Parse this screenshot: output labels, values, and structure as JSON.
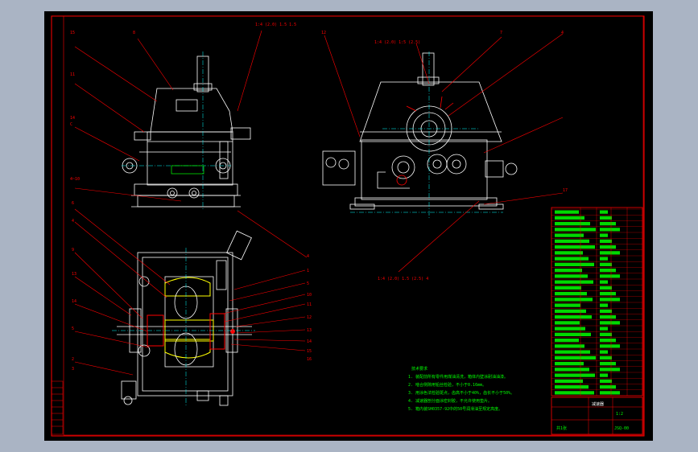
{
  "drawing": {
    "background": "#000000",
    "frame_color": "#ff0000",
    "line_color": "#ffffff",
    "dim_color": "#00ffff",
    "part_color": "#ffff00",
    "note_color": "#00ff00",
    "leader_color": "#ff0000"
  },
  "view_labels": {
    "front_top": "1:4 (2.0) 1.5 1.5",
    "side_top": "1:4 (2.0) 1:5 (2.5)",
    "side_bottom": "1:4 (2.0) 1.5 (2.5) 4"
  },
  "balloons_left": [
    "15",
    "11",
    "14",
    "C",
    "4~10"
  ],
  "balloons_top": [
    "8",
    "12",
    "7",
    "4"
  ],
  "balloons_plan_left": [
    "6",
    "4",
    "9",
    "13",
    "14",
    "5",
    "2",
    "3"
  ],
  "balloons_plan_right": [
    "4",
    "1",
    "5",
    "10",
    "11",
    "12",
    "13",
    "14",
    "15",
    "16",
    "17"
  ],
  "tech_notes": {
    "title": "技术要求",
    "lines": [
      "1. 装配前所有零件用煤油清洗，箱体内壁涂耐油油漆。",
      "2. 啮合侧隙用铅丝检验，不小于0.16mm。",
      "3. 用涂色法检验斑点，齿高不小于40%，齿长不小于50%。",
      "4. 减速器剖分面涂密封胶，不允许使用垫片。",
      "5. 箱内装SH0357-92中的50号润滑油至规定高度。"
    ]
  },
  "title_block": {
    "title": "减速器",
    "drawing_no": "JSQ-00",
    "scale": "1:2",
    "sheet": "共1张"
  },
  "parts_count": 32
}
